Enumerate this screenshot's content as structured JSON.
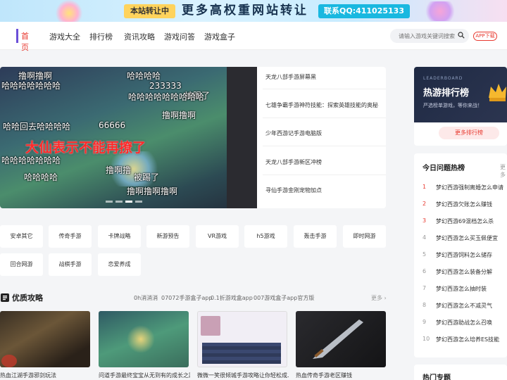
{
  "promo": {
    "tag": "本站转让中",
    "text": "更多高权重网站转让",
    "qq": "联系QQ:411025133"
  },
  "nav": {
    "logo_text": "首页",
    "items": [
      "游戏大全",
      "排行榜",
      "资讯攻略",
      "游戏问答",
      "游戏盒子"
    ],
    "search_placeholder": "请输入游戏关键词搜索",
    "app_button": "APP下载"
  },
  "slider": {
    "danmaku": [
      "撸啊撸啊",
      "哈哈哈哈哈哈哈",
      "哈哈哈哈",
      "233333",
      "被踢了",
      "66666",
      "大仙表示不能再撩了",
      "哈哈回去哈哈哈哈",
      "撸啊撸啊",
      "哈哈哈哈哈哈哈",
      "撸啊撸",
      "被踢了",
      "哈哈哈哈",
      "哈哈哈哈哈哈哈哈哈",
      "撸啊撸啊撸啊"
    ],
    "items": [
      "天龙八部手游屏幕黑",
      "七雄争霸手游神符技能：探索英雄技能的奥秘",
      "少年西游记手游电脑版",
      "天龙八部手游新区冲榜",
      "寻仙手游金刚宠物加点"
    ]
  },
  "tags": [
    "安卓其它",
    "传奇手游",
    "卡牌战略",
    "新游预告",
    "VR游戏",
    "h5游戏",
    "轰击手游",
    "即时网游",
    "回合网游",
    "战棋手游",
    "恋爱养成"
  ],
  "guides": {
    "title": "优质攻略",
    "links": [
      "0h消消消",
      "07072手游盒子app",
      "0.1折游戏盒app",
      "007游戏盒子app官方版"
    ],
    "more": "更多 ›",
    "cards": [
      "热血江湖手游邪剑玩法",
      "问道手游最终宝宝从无到有的成长之路",
      "微微一笑很倾城手游攻略让你轻松成…",
      "热血传奇手游老区赚钱"
    ]
  },
  "leaderboard": {
    "en": "LEADERBOARD",
    "title": "热游排行榜",
    "subtitle": "严选榜单游戏，等你来战！",
    "button": "更多排行榜"
  },
  "hot": {
    "title": "今日问题热榜",
    "more": "更多",
    "items": [
      {
        "num": "1",
        "text": "梦幻西游强制离婚怎么申请"
      },
      {
        "num": "2",
        "text": "梦幻西游欠账怎么赚钱"
      },
      {
        "num": "3",
        "text": "梦幻西游69混档怎么杀"
      },
      {
        "num": "4",
        "text": "梦幻西游怎么买玉佩便宜"
      },
      {
        "num": "5",
        "text": "梦幻西游饲料怎么储存"
      },
      {
        "num": "6",
        "text": "梦幻西游怎么装备分解"
      },
      {
        "num": "7",
        "text": "梦幻西游怎么抽时装"
      },
      {
        "num": "8",
        "text": "梦幻西游怎么不减灵气"
      },
      {
        "num": "9",
        "text": "梦幻西游助战怎么召唤"
      },
      {
        "num": "10",
        "text": "梦幻西游怎么培养ES技能"
      }
    ]
  },
  "topics": {
    "title": "热门专题"
  },
  "colors": {
    "accent": "#e8392f",
    "brand": "#6b4fd8"
  }
}
